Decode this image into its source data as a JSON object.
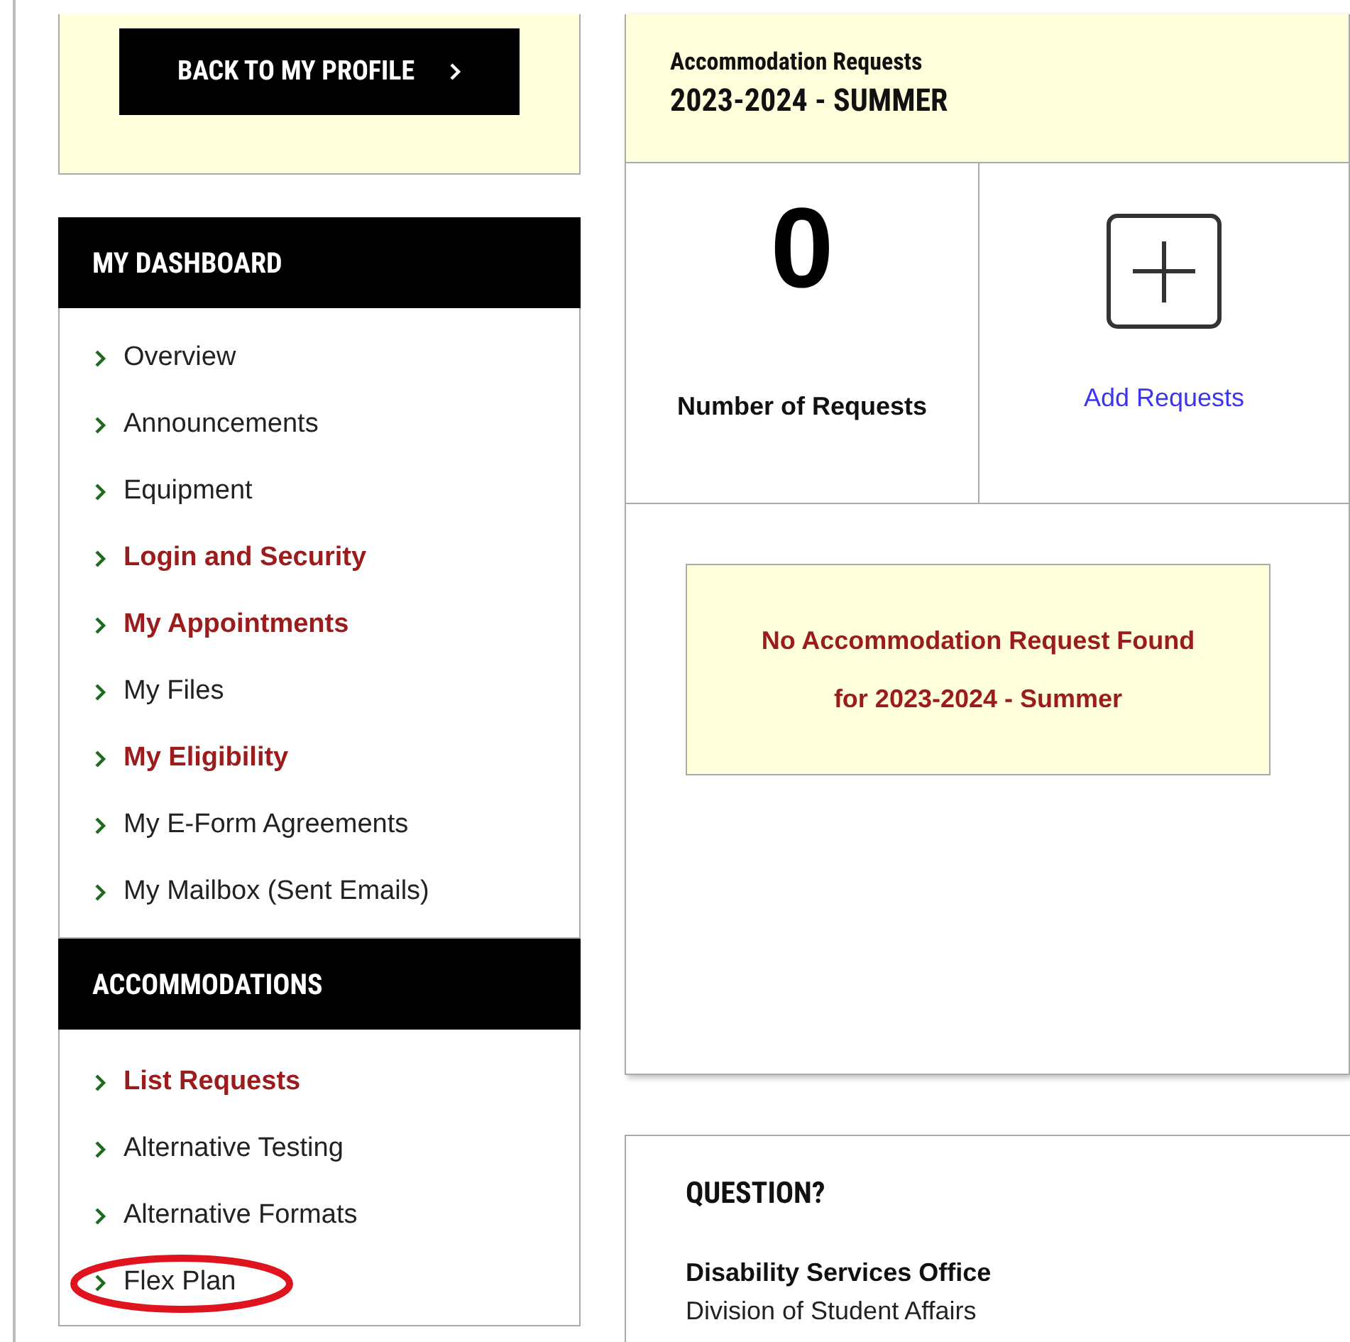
{
  "profile_button": {
    "label": "BACK TO MY PROFILE"
  },
  "sections": [
    {
      "title": "MY DASHBOARD",
      "items": [
        {
          "label": "Overview",
          "emphasized": false,
          "circled": false
        },
        {
          "label": "Announcements",
          "emphasized": false,
          "circled": false
        },
        {
          "label": "Equipment",
          "emphasized": false,
          "circled": false
        },
        {
          "label": "Login and Security",
          "emphasized": true,
          "circled": false
        },
        {
          "label": "My Appointments",
          "emphasized": true,
          "circled": false
        },
        {
          "label": "My Files",
          "emphasized": false,
          "circled": false
        },
        {
          "label": "My Eligibility",
          "emphasized": true,
          "circled": false
        },
        {
          "label": "My E-Form Agreements",
          "emphasized": false,
          "circled": false
        },
        {
          "label": "My Mailbox (Sent Emails)",
          "emphasized": false,
          "circled": false
        }
      ]
    },
    {
      "title": "ACCOMMODATIONS",
      "items": [
        {
          "label": "List Requests",
          "emphasized": true,
          "circled": false
        },
        {
          "label": "Alternative Testing",
          "emphasized": false,
          "circled": false
        },
        {
          "label": "Alternative Formats",
          "emphasized": false,
          "circled": false
        },
        {
          "label": "Flex Plan",
          "emphasized": false,
          "circled": true
        }
      ]
    }
  ],
  "requests": {
    "title": "Accommodation Requests",
    "term": "2023-2024 - SUMMER",
    "count": "0",
    "count_label": "Number of Requests",
    "add_label": "Add Requests",
    "notice_lines": [
      "No Accommodation Request Found",
      "for 2023-2024 - Summer"
    ]
  },
  "question": {
    "title": "QUESTION?",
    "office": "Disability Services Office",
    "division": "Division of Student Affairs"
  }
}
